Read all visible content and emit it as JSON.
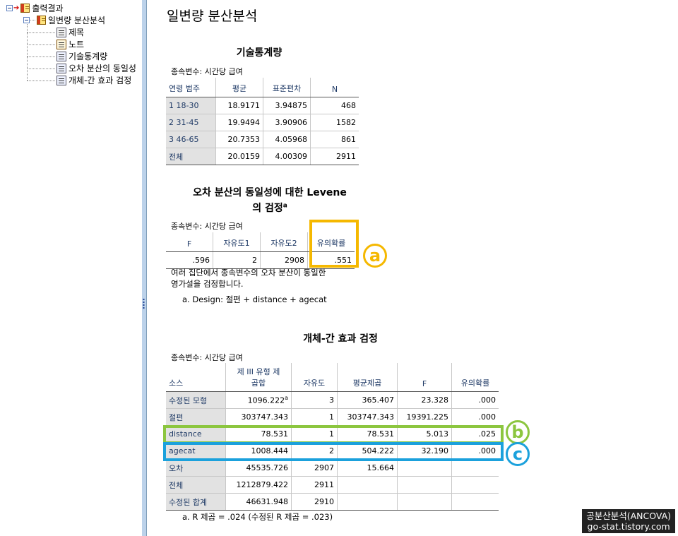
{
  "tree": {
    "root_label": "출력결과",
    "analysis_label": "일변량 분산분석",
    "children": [
      "제목",
      "노트",
      "기술통계량",
      "오차 분산의 동일성",
      "개체-간 효과 검정"
    ]
  },
  "page_title": "일변량 분산분석",
  "descriptives": {
    "title": "기술통계량",
    "dv_label": "종속변수:  시간당 급여",
    "headers": [
      "연령 범주",
      "평균",
      "표준편차",
      "N"
    ],
    "rows": [
      [
        "1 18-30",
        "18.9171",
        "3.94875",
        "468"
      ],
      [
        "2 31-45",
        "19.9494",
        "3.90906",
        "1582"
      ],
      [
        "3 46-65",
        "20.7353",
        "4.05968",
        "861"
      ],
      [
        "전체",
        "20.0159",
        "4.00309",
        "2911"
      ]
    ]
  },
  "levene": {
    "title_line1": "오차 분산의 동일성에 대한 Levene",
    "title_line2": "의 검정",
    "title_sup": "a",
    "dv_label": "종속변수:  시간당 급여",
    "headers": [
      "F",
      "자유도1",
      "자유도2",
      "유의확률"
    ],
    "row": [
      ".596",
      "2",
      "2908",
      ".551"
    ],
    "note_line1": "여러 집단에서 종속변수의 오차 분산이 동일한",
    "note_line2": "영가설을 검정합니다.",
    "footnote": "a. Design: 절편 + distance + agecat"
  },
  "tests": {
    "title": "개체-간 효과 검정",
    "dv_label": "종속변수:  시간당 급여",
    "headers": [
      "소스",
      "제 III 유형 제\n곱합",
      "자유도",
      "평균제곱",
      "F",
      "유의확률"
    ],
    "rows": [
      {
        "source": "수정된 모형",
        "ss": "1096.222",
        "ss_sup": "a",
        "df": "3",
        "ms": "365.407",
        "f": "23.328",
        "sig": ".000"
      },
      {
        "source": "절편",
        "ss": "303747.343",
        "ss_sup": "",
        "df": "1",
        "ms": "303747.343",
        "f": "19391.225",
        "sig": ".000"
      },
      {
        "source": "distance",
        "ss": "78.531",
        "ss_sup": "",
        "df": "1",
        "ms": "78.531",
        "f": "5.013",
        "sig": ".025"
      },
      {
        "source": "agecat",
        "ss": "1008.444",
        "ss_sup": "",
        "df": "2",
        "ms": "504.222",
        "f": "32.190",
        "sig": ".000"
      },
      {
        "source": "오차",
        "ss": "45535.726",
        "ss_sup": "",
        "df": "2907",
        "ms": "15.664",
        "f": "",
        "sig": ""
      },
      {
        "source": "전체",
        "ss": "1212879.422",
        "ss_sup": "",
        "df": "2911",
        "ms": "",
        "f": "",
        "sig": ""
      },
      {
        "source": "수정된 합계",
        "ss": "46631.948",
        "ss_sup": "",
        "df": "2910",
        "ms": "",
        "f": "",
        "sig": ""
      }
    ],
    "footnote": "a. R 제곱 = .024 (수정된 R 제곱 = .023)"
  },
  "annotations": {
    "a": {
      "label": "a",
      "color": "#f5b800"
    },
    "b": {
      "label": "b",
      "color": "#8cc63f"
    },
    "c": {
      "label": "c",
      "color": "#1ba1dc"
    }
  },
  "watermark": {
    "line1": "공분산분석(ANCOVA)",
    "line2": "go-stat.tistory.com"
  }
}
